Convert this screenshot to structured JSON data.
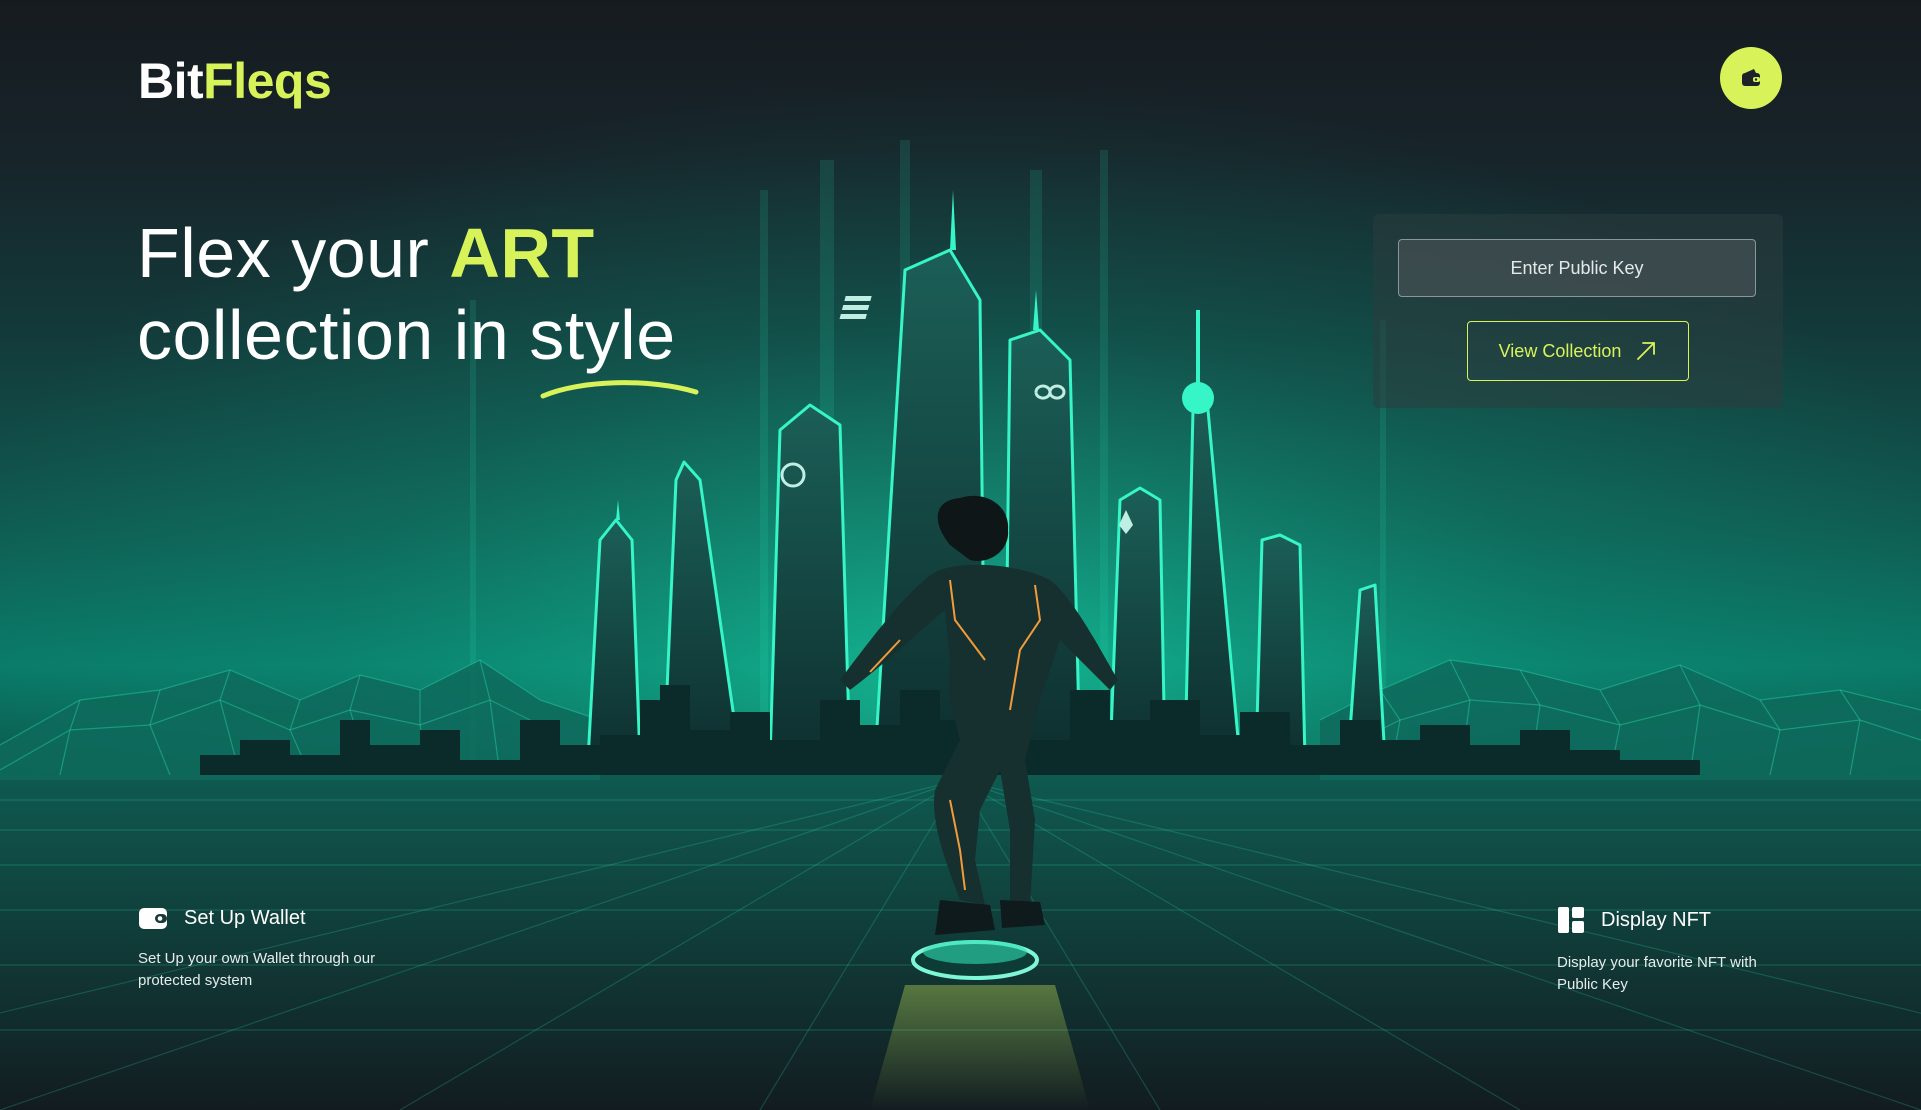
{
  "brand": {
    "name_white": "Bit",
    "name_accent": "Fleqs"
  },
  "header": {
    "wallet_icon": "wallet-icon"
  },
  "hero": {
    "line1_plain": "Flex your ",
    "line1_accent": "ART",
    "line2": "collection in style"
  },
  "panel": {
    "input_placeholder": "Enter Public Key",
    "input_value": "",
    "button_label": "View Collection",
    "button_icon": "arrow-up-right-icon"
  },
  "features": [
    {
      "icon": "wallet-icon",
      "title": "Set Up Wallet",
      "description": "Set Up your own Wallet through our protected system"
    },
    {
      "icon": "layout-grid-icon",
      "title": "Display NFT",
      "description": "Display your favorite NFT with Public Key"
    }
  ],
  "colors": {
    "accent": "#d8f35a",
    "background": "#161b1f",
    "teal": "#1de9b6"
  }
}
